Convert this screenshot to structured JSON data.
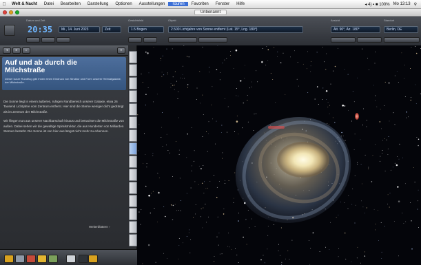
{
  "menubar": {
    "app_name": "Welt & Nacht",
    "items": [
      "Datei",
      "Bearbeiten",
      "Darstellung",
      "Optionen",
      "Ausstellungen",
      "Touren",
      "Favoriten",
      "Fenster",
      "Hilfe"
    ],
    "status": [
      "◂ 4) ▪ ■ 100%",
      "Mo 13:13"
    ],
    "accent": "#3b6fd6"
  },
  "window": {
    "title": "Unbenannt"
  },
  "controls": {
    "date_label": "Datum und Zeit",
    "clock": "20:35",
    "date_value": "Mi., 14. Juni 2023",
    "date_suffix": "Zeit",
    "field_label": "Gesichtsfeld",
    "field_value": "1.5 Bogen",
    "target_label": "Objekt",
    "target_value": "2.500 Lichtjahre von Sonne entfernt (Lat. 15°, Lng. 180°)",
    "view_label": "Ansicht",
    "view_value": "Alt. 90°, Az. 180°",
    "location_label": "Standort",
    "location_value": "Berlin, DE"
  },
  "sidebar": {
    "toolbar_buttons": [
      "◂",
      "▸",
      "⌂",
      "≡"
    ],
    "tour_title": "Auf und ab durch die Milchstraße",
    "tour_subtitle": "Dieser kurze Rundflug gibt Ihnen einen Eindruck von Struktur und Form unserer Heimatgalaxie, der Milchstraße.",
    "paragraphs": [
      "Die Sonne liegt in einem äußeren, ruhigen Randbereich unserer Galaxie, etwa 26 Tausend Lichtjahre vom Zentrum entfernt. Hier sind die Sterne weniger dicht gedrängt als im Zentrum der Milchstraße.",
      "Wir fliegen nun aus unserer Nachbarschaft hinaus und betrachten die Milchstraße von außen. Dabei sehen wir die gewaltige Spiralstruktur, die aus Hunderten von Milliarden Sternen besteht. Die Sonne ist von hier aus längst nicht mehr zu erkennen."
    ],
    "more_link": "Weiterblättern ›"
  },
  "bottom_toolbar": {
    "button_colors": [
      "#d9a21f",
      "#8f9aa8",
      "#c44a3a",
      "#e2b531",
      "#7ba05b",
      "#cfd3d8",
      "#2f3338"
    ]
  },
  "sky": {
    "background": "#04050a"
  }
}
